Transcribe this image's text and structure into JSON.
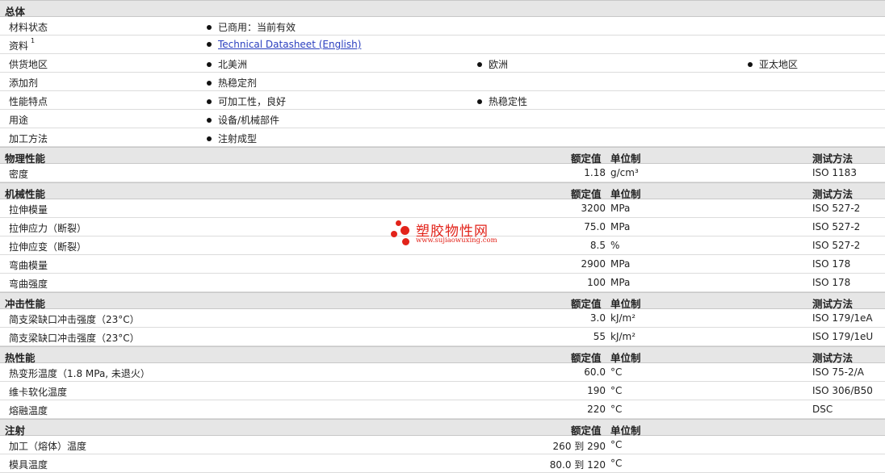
{
  "sections": {
    "general": {
      "title": "总体"
    },
    "physical": {
      "title": "物理性能",
      "nominal": "额定值",
      "unit": "单位制",
      "test": "测试方法"
    },
    "mechanical": {
      "title": "机械性能",
      "nominal": "额定值",
      "unit": "单位制",
      "test": "测试方法"
    },
    "impact": {
      "title": "冲击性能",
      "nominal": "额定值",
      "unit": "单位制",
      "test": "测试方法"
    },
    "thermal": {
      "title": "热性能",
      "nominal": "额定值",
      "unit": "单位制",
      "test": "测试方法"
    },
    "injection": {
      "title": "注射",
      "nominal": "额定值",
      "unit": "单位制"
    }
  },
  "general": {
    "status_label": "材料状态",
    "status_value": "已商用：当前有效",
    "docs_label": "资料",
    "docs_sup": "1",
    "docs_link": "Technical Datasheet (English)",
    "region_label": "供货地区",
    "region_1": "北美洲",
    "region_2": "欧洲",
    "region_3": "亚太地区",
    "additive_label": "添加剂",
    "additive_1": "热稳定剂",
    "features_label": "性能特点",
    "features_1": "可加工性，良好",
    "features_2": "热稳定性",
    "uses_label": "用途",
    "uses_1": "设备/机械部件",
    "method_label": "加工方法",
    "method_1": "注射成型"
  },
  "physical": [
    {
      "name": "密度",
      "value": "1.18",
      "unit": "g/cm³",
      "test": "ISO 1183"
    }
  ],
  "mechanical": [
    {
      "name": "拉伸模量",
      "value": "3200",
      "unit": "MPa",
      "test": "ISO 527-2"
    },
    {
      "name": "拉伸应力（断裂）",
      "value": "75.0",
      "unit": "MPa",
      "test": "ISO 527-2"
    },
    {
      "name": "拉伸应变（断裂）",
      "value": "8.5",
      "unit": "%",
      "test": "ISO 527-2"
    },
    {
      "name": "弯曲模量",
      "value": "2900",
      "unit": "MPa",
      "test": "ISO 178"
    },
    {
      "name": "弯曲强度",
      "value": "100",
      "unit": "MPa",
      "test": "ISO 178"
    }
  ],
  "impact": [
    {
      "name": "简支梁缺口冲击强度（23°C）",
      "value": "3.0",
      "unit": "kJ/m²",
      "test": "ISO 179/1eA"
    },
    {
      "name": "简支梁缺口冲击强度（23°C）",
      "value": "55",
      "unit": "kJ/m²",
      "test": "ISO 179/1eU"
    }
  ],
  "thermal": [
    {
      "name": "热变形温度（1.8 MPa, 未退火）",
      "value": "60.0",
      "unit": "°C",
      "test": "ISO 75-2/A"
    },
    {
      "name": "维卡软化温度",
      "value": "190",
      "unit": "°C",
      "test": "ISO 306/B50"
    },
    {
      "name": "熔融温度",
      "value": "220",
      "unit": "°C",
      "test": "DSC"
    }
  ],
  "injection": [
    {
      "name": "加工（熔体）温度",
      "value": "260 到  290",
      "unit": "°C"
    },
    {
      "name": "模具温度",
      "value": "80.0 到  120",
      "unit": "°C"
    }
  ],
  "watermark": {
    "brand": "塑胶物性网",
    "url": "www.sujiaowuxing.com",
    "color": "#e2231a"
  }
}
